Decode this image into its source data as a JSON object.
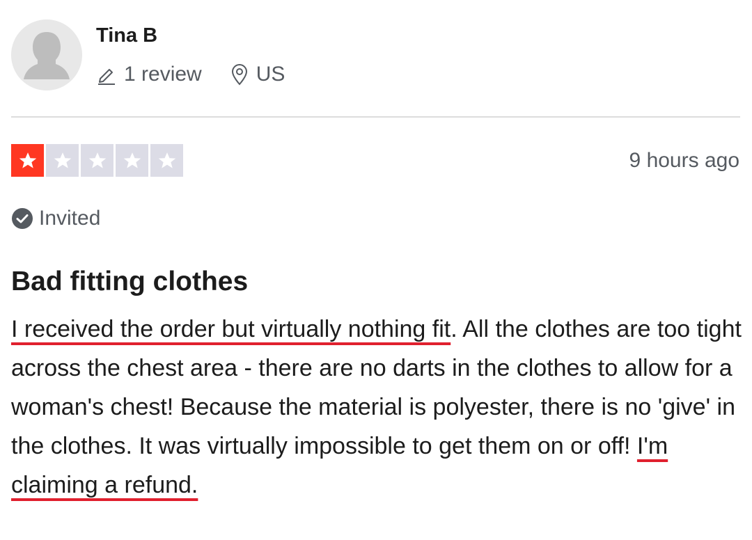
{
  "reviewer": {
    "name": "Tina B",
    "review_count": "1 review",
    "location": "US",
    "avatar_icon": "user-silhouette-icon"
  },
  "rating": {
    "stars": 1,
    "max_stars": 5,
    "color": "#ff3722",
    "empty_color": "#dcdce6"
  },
  "timestamp": "9 hours ago",
  "badge": {
    "label": "Invited",
    "icon": "check-circle-icon"
  },
  "review": {
    "title": "Bad fitting clothes",
    "body_parts": {
      "highlight_1": "I received the order but virtually nothing fit",
      "text_1": ". All the clothes are too tight across the chest area - there are no darts in the clothes to allow for a woman's chest! Because the material is polyester, there is no 'give' in the clothes. It was virtually impossible to get them on or off! ",
      "highlight_2": "I'm claiming a refund."
    },
    "highlight_color": "#e0202e"
  },
  "icons": {
    "review_count_icon": "pencil-icon",
    "location_icon": "location-pin-icon"
  }
}
